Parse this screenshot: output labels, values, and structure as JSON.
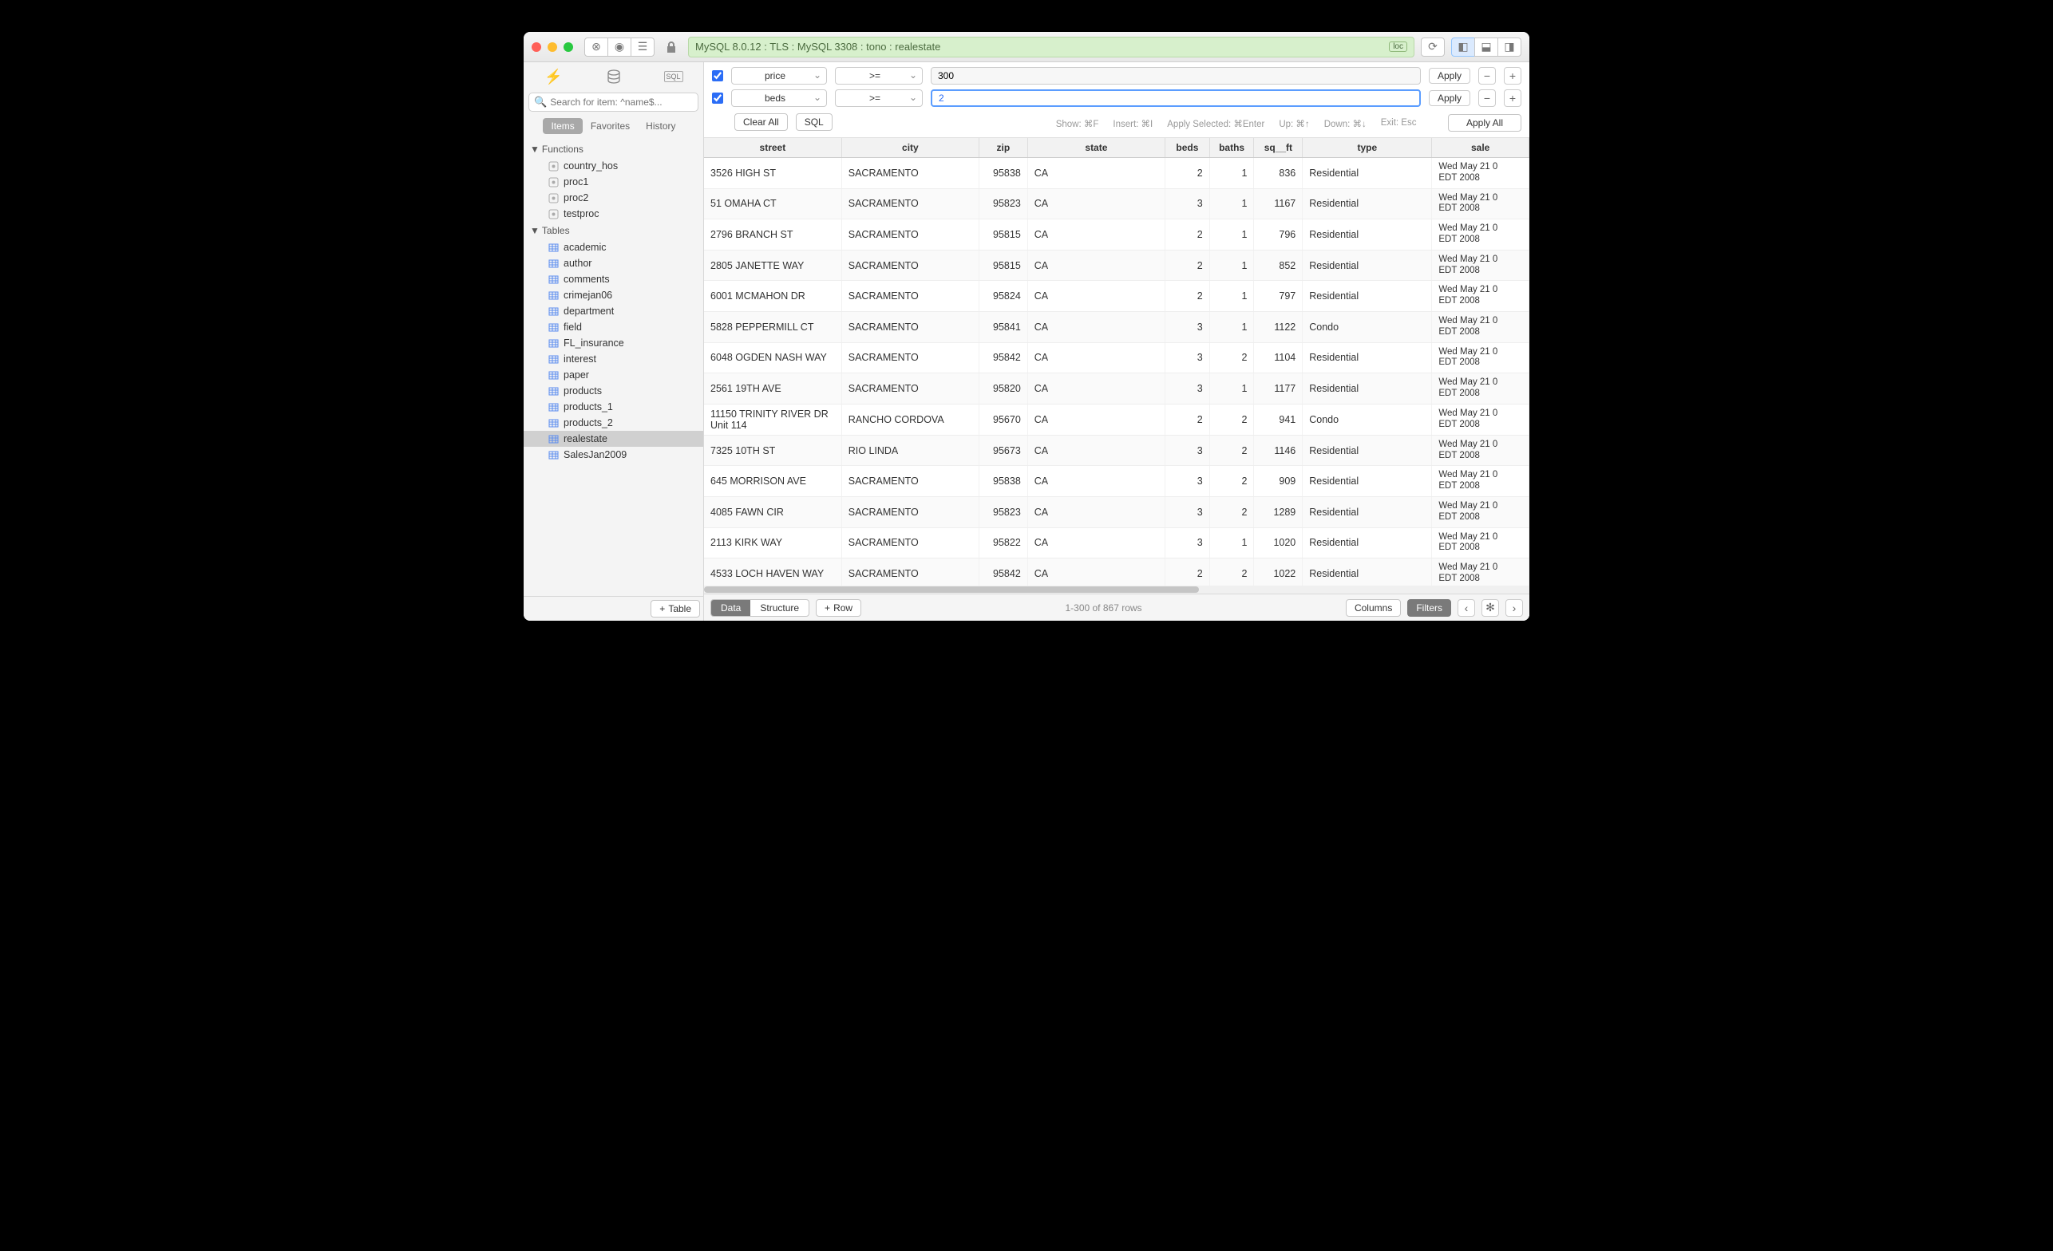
{
  "titlebar": {
    "connection": "MySQL 8.0.12 : TLS : MySQL 3308 : tono : realestate",
    "loc_badge": "loc"
  },
  "sidebar": {
    "search_placeholder": "Search for item: ^name$...",
    "modes": {
      "items": "Items",
      "favorites": "Favorites",
      "history": "History"
    },
    "groups": {
      "functions": {
        "label": "Functions",
        "items": [
          "country_hos",
          "proc1",
          "proc2",
          "testproc"
        ]
      },
      "tables": {
        "label": "Tables",
        "items": [
          "academic",
          "author",
          "comments",
          "crimejan06",
          "department",
          "field",
          "FL_insurance",
          "interest",
          "paper",
          "products",
          "products_1",
          "products_2",
          "realestate",
          "SalesJan2009"
        ],
        "selected": "realestate"
      }
    },
    "add_table": "Table"
  },
  "filters": {
    "rows": [
      {
        "checked": true,
        "column": "price",
        "op": ">=",
        "value": "300",
        "focused": false
      },
      {
        "checked": true,
        "column": "beds",
        "op": ">=",
        "value": "2",
        "focused": true
      }
    ],
    "clear_all": "Clear All",
    "sql": "SQL",
    "apply": "Apply",
    "apply_all": "Apply All",
    "hints": {
      "show": "Show: ⌘F",
      "insert": "Insert: ⌘I",
      "apply_sel": "Apply Selected: ⌘Enter",
      "up": "Up: ⌘↑",
      "down": "Down: ⌘↓",
      "exit": "Exit: Esc"
    }
  },
  "table": {
    "columns": [
      "street",
      "city",
      "zip",
      "state",
      "beds",
      "baths",
      "sq__ft",
      "type",
      "sale"
    ],
    "rows": [
      {
        "street": "3526 HIGH ST",
        "city": "SACRAMENTO",
        "zip": "95838",
        "state": "CA",
        "beds": "2",
        "baths": "1",
        "sqft": "836",
        "type": "Residential",
        "sale": "Wed May 21 0\nEDT 2008"
      },
      {
        "street": "51 OMAHA CT",
        "city": "SACRAMENTO",
        "zip": "95823",
        "state": "CA",
        "beds": "3",
        "baths": "1",
        "sqft": "1167",
        "type": "Residential",
        "sale": "Wed May 21 0\nEDT 2008"
      },
      {
        "street": "2796 BRANCH ST",
        "city": "SACRAMENTO",
        "zip": "95815",
        "state": "CA",
        "beds": "2",
        "baths": "1",
        "sqft": "796",
        "type": "Residential",
        "sale": "Wed May 21 0\nEDT 2008"
      },
      {
        "street": "2805 JANETTE WAY",
        "city": "SACRAMENTO",
        "zip": "95815",
        "state": "CA",
        "beds": "2",
        "baths": "1",
        "sqft": "852",
        "type": "Residential",
        "sale": "Wed May 21 0\nEDT 2008"
      },
      {
        "street": "6001 MCMAHON DR",
        "city": "SACRAMENTO",
        "zip": "95824",
        "state": "CA",
        "beds": "2",
        "baths": "1",
        "sqft": "797",
        "type": "Residential",
        "sale": "Wed May 21 0\nEDT 2008"
      },
      {
        "street": "5828 PEPPERMILL CT",
        "city": "SACRAMENTO",
        "zip": "95841",
        "state": "CA",
        "beds": "3",
        "baths": "1",
        "sqft": "1122",
        "type": "Condo",
        "sale": "Wed May 21 0\nEDT 2008"
      },
      {
        "street": "6048 OGDEN NASH WAY",
        "city": "SACRAMENTO",
        "zip": "95842",
        "state": "CA",
        "beds": "3",
        "baths": "2",
        "sqft": "1104",
        "type": "Residential",
        "sale": "Wed May 21 0\nEDT 2008"
      },
      {
        "street": "2561 19TH AVE",
        "city": "SACRAMENTO",
        "zip": "95820",
        "state": "CA",
        "beds": "3",
        "baths": "1",
        "sqft": "1177",
        "type": "Residential",
        "sale": "Wed May 21 0\nEDT 2008"
      },
      {
        "street": "11150 TRINITY RIVER DR Unit 114",
        "city": "RANCHO CORDOVA",
        "zip": "95670",
        "state": "CA",
        "beds": "2",
        "baths": "2",
        "sqft": "941",
        "type": "Condo",
        "sale": "Wed May 21 0\nEDT 2008"
      },
      {
        "street": "7325 10TH ST",
        "city": "RIO LINDA",
        "zip": "95673",
        "state": "CA",
        "beds": "3",
        "baths": "2",
        "sqft": "1146",
        "type": "Residential",
        "sale": "Wed May 21 0\nEDT 2008"
      },
      {
        "street": "645 MORRISON AVE",
        "city": "SACRAMENTO",
        "zip": "95838",
        "state": "CA",
        "beds": "3",
        "baths": "2",
        "sqft": "909",
        "type": "Residential",
        "sale": "Wed May 21 0\nEDT 2008"
      },
      {
        "street": "4085 FAWN CIR",
        "city": "SACRAMENTO",
        "zip": "95823",
        "state": "CA",
        "beds": "3",
        "baths": "2",
        "sqft": "1289",
        "type": "Residential",
        "sale": "Wed May 21 0\nEDT 2008"
      },
      {
        "street": "2113 KIRK WAY",
        "city": "SACRAMENTO",
        "zip": "95822",
        "state": "CA",
        "beds": "3",
        "baths": "1",
        "sqft": "1020",
        "type": "Residential",
        "sale": "Wed May 21 0\nEDT 2008"
      },
      {
        "street": "4533 LOCH HAVEN WAY",
        "city": "SACRAMENTO",
        "zip": "95842",
        "state": "CA",
        "beds": "2",
        "baths": "2",
        "sqft": "1022",
        "type": "Residential",
        "sale": "Wed May 21 0\nEDT 2008"
      }
    ]
  },
  "bottombar": {
    "data": "Data",
    "structure": "Structure",
    "row": "Row",
    "rowcount": "1-300 of 867 rows",
    "columns": "Columns",
    "filters": "Filters"
  }
}
